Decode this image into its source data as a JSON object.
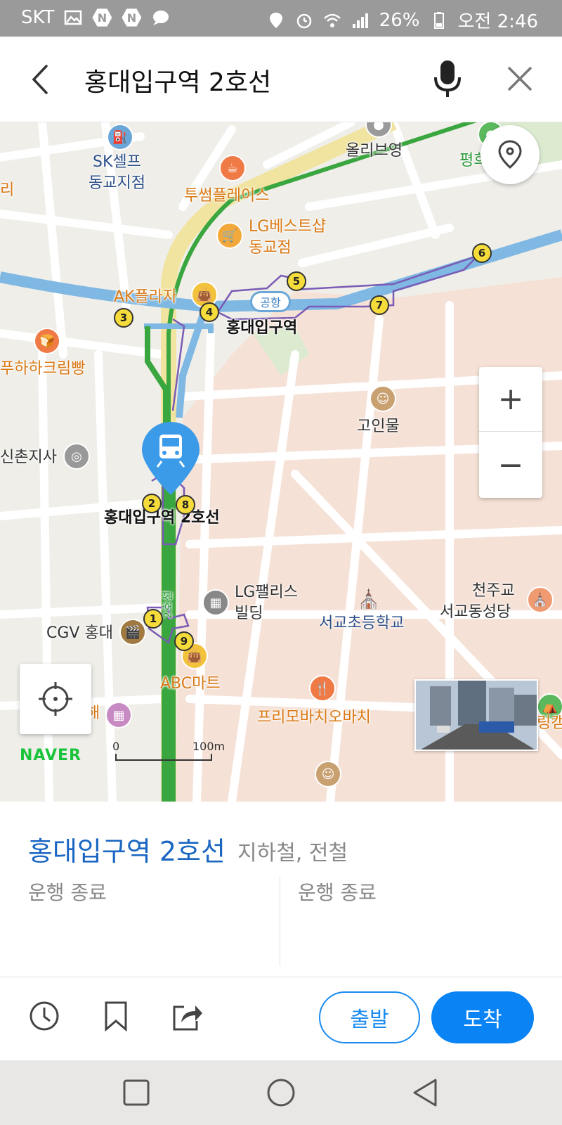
{
  "status_bar": {
    "carrier": "SKT",
    "notif_badge_1": "N",
    "notif_badge_2": "N",
    "battery": "26%",
    "time": "오전 2:46"
  },
  "search": {
    "query": "홍대입구역 2호선"
  },
  "map": {
    "labels": {
      "sk_self_1": "SK셀프",
      "sk_self_2": "동교지점",
      "olive_young": "올리브영",
      "pyeong": "평희",
      "twosome": "투썸플레이스",
      "lg_best_1": "LG베스트샵",
      "lg_best_2": "동교점",
      "ak_plaza": "AK플라자",
      "hongdae_station": "홍대입구역",
      "puhaha": "푸하하크림빵",
      "goinmul": "고인물",
      "sinchon": "신촌지사",
      "hongdae_line2": "홍대입구역 2호선",
      "lg_palace_1": "LG팰리스",
      "lg_palace_2": "빌딩",
      "seogyo_school": "서교초등학교",
      "cathedral_1": "천주교",
      "cathedral_2": "서교동성당",
      "cgv": "CGV 홍대",
      "line2_track": "2호선",
      "abc_mart": "ABC마트",
      "primo": "프리모바치오바치",
      "left_ri": "리",
      "left_hae": "해",
      "right_ring": "링캠"
    },
    "airport_badge": "공항",
    "exits": [
      "1",
      "2",
      "3",
      "4",
      "5",
      "6",
      "7",
      "8",
      "9"
    ],
    "zoom_in": "+",
    "zoom_out": "−",
    "naver_logo": "NAVER",
    "scale_start": "0",
    "scale_end": "100m"
  },
  "place": {
    "name": "홍대입구역 2호선",
    "category": "지하철, 전철",
    "status_left": "운행 종료",
    "status_right": "운행 종료"
  },
  "actions": {
    "depart": "출발",
    "arrive": "도착"
  },
  "colors": {
    "accent_blue": "#0a84f5",
    "title_blue": "#1a66c2",
    "line2_green": "#3aa63f",
    "airport_line": "#7fb8e3"
  }
}
